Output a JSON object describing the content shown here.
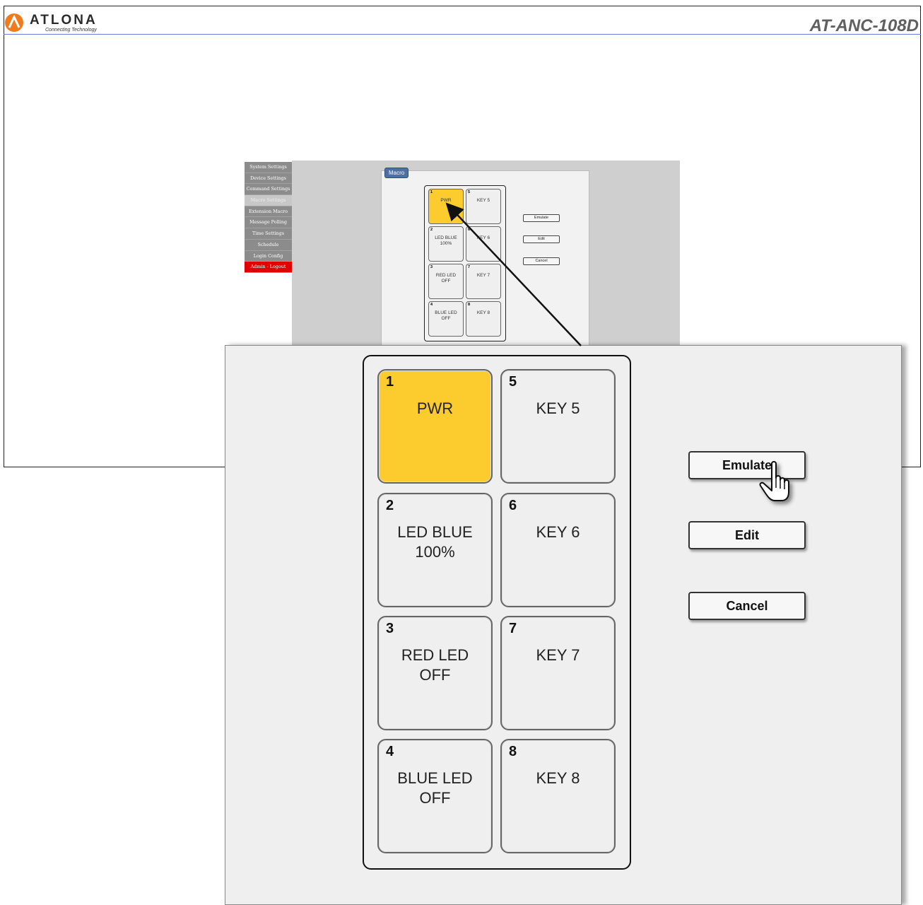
{
  "brand": {
    "name": "ATLONA",
    "tagline": "Connecting Technology",
    "model": "AT-ANC-108D",
    "accent": "#f07a1e"
  },
  "sidebar": {
    "items": [
      {
        "label": "System Settings"
      },
      {
        "label": "Device Settings"
      },
      {
        "label": "Command Settings"
      },
      {
        "label": "Macro Settings"
      },
      {
        "label": "Extension Macro"
      },
      {
        "label": "Message Polling"
      },
      {
        "label": "Time Settings"
      },
      {
        "label": "Schedule"
      },
      {
        "label": "Login Config"
      },
      {
        "label": "Admin - Logout"
      }
    ]
  },
  "panel": {
    "title": "Macro"
  },
  "keys": [
    {
      "number": "1",
      "label": "PWR"
    },
    {
      "number": "2",
      "label": "LED BLUE\n100%"
    },
    {
      "number": "3",
      "label": "RED LED\nOFF"
    },
    {
      "number": "4",
      "label": "BLUE LED\nOFF"
    },
    {
      "number": "5",
      "label": "KEY 5"
    },
    {
      "number": "6",
      "label": "KEY 6"
    },
    {
      "number": "7",
      "label": "KEY 7"
    },
    {
      "number": "8",
      "label": "KEY 8"
    }
  ],
  "buttons": {
    "emulate": "Emulate",
    "edit": "Edit",
    "cancel": "Cancel"
  },
  "colors": {
    "selected_key": "#fccc2f",
    "logout": "#e00000",
    "tag": "#4d6fa3"
  }
}
